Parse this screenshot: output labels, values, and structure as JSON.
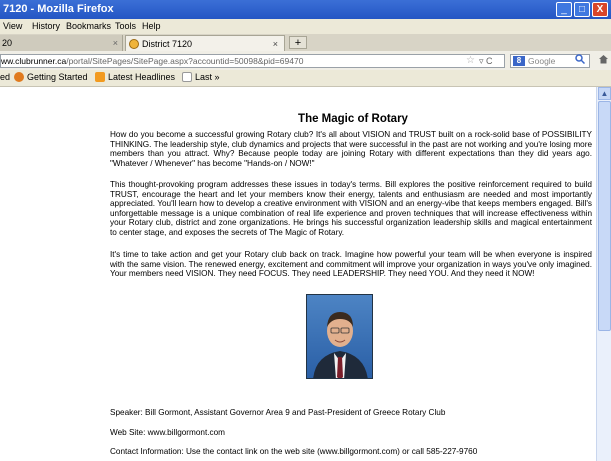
{
  "window": {
    "title": "7120 - Mozilla Firefox",
    "min": "_",
    "max": "□",
    "close": "X"
  },
  "menu": [
    "View",
    "History",
    "Bookmarks",
    "Tools",
    "Help"
  ],
  "tabs": {
    "first_label": "20",
    "first_close": "×",
    "active_label": "District 7120",
    "active_close": "×",
    "new_tab": "+"
  },
  "url": {
    "host": "ww.clubrunner.ca",
    "path": "/portal/SitePages/SitePage.aspx?accountid=50098&pid=69470",
    "star": "☆",
    "controls": "▿ C"
  },
  "search": {
    "engine_letter": "8",
    "placeholder": "Google",
    "icon": "magnifier-icon"
  },
  "bookmarks": [
    {
      "label": "ed",
      "icon": ""
    },
    {
      "label": "Getting Started",
      "icon": "firefox-icon"
    },
    {
      "label": "Latest Headlines",
      "icon": "rss-icon"
    },
    {
      "label": "Last »",
      "icon": "folder-icon"
    }
  ],
  "page": {
    "title": "The Magic of Rotary",
    "paragraphs": [
      "How do you become a successful growing Rotary club?  It's all about VISION and TRUST built on a rock-solid base of POSSIBILITY THINKING.  The leadership style, club dynamics and projects that were successful in the past are not working and you're losing more members than you attract.  Why?  Because people today are joining Rotary with different expectations than they did years ago.  \"Whatever / Whenever\" has become \"Hands-on / NOW!\"",
      "This thought-provoking program addresses these issues in today's terms.  Bill explores the positive reinforcement required to build TRUST, encourage the heart and let your members know their energy, talents and enthusiasm are needed and most importantly appreciated.  You'll learn how to develop a creative environment with VISION and an energy-vibe that keeps members engaged.  Bill's unforgettable message is a unique combination of real life experience and proven techniques that will increase effectiveness within your Rotary club, district and zone organizations.  He brings his successful organization leadership skills and magical entertainment to center stage, and exposes the secrets of The Magic of Rotary.",
      "It's time to take action and get your Rotary club back on track.  Imagine how powerful your team will be when everyone is inspired with the same vision.  The renewed energy, excitement and commitment will improve your organization in ways you've only imagined.  Your members need VISION.  They need FOCUS.  They need LEADERSHIP.  They need YOU.  And they need it NOW!"
    ],
    "speaker": "Speaker: Bill Gormont, Assistant Governor Area 9 and Past-President of Greece Rotary Club",
    "website": "Web Site: www.billgormont.com",
    "contact": "Contact Information: Use the contact link on the web site (www.billgormont.com) or call 585-227-9760"
  },
  "colors": {
    "titlebar": "#2456c4",
    "close_button": "#d9462a",
    "chrome": "#ece9d8"
  }
}
